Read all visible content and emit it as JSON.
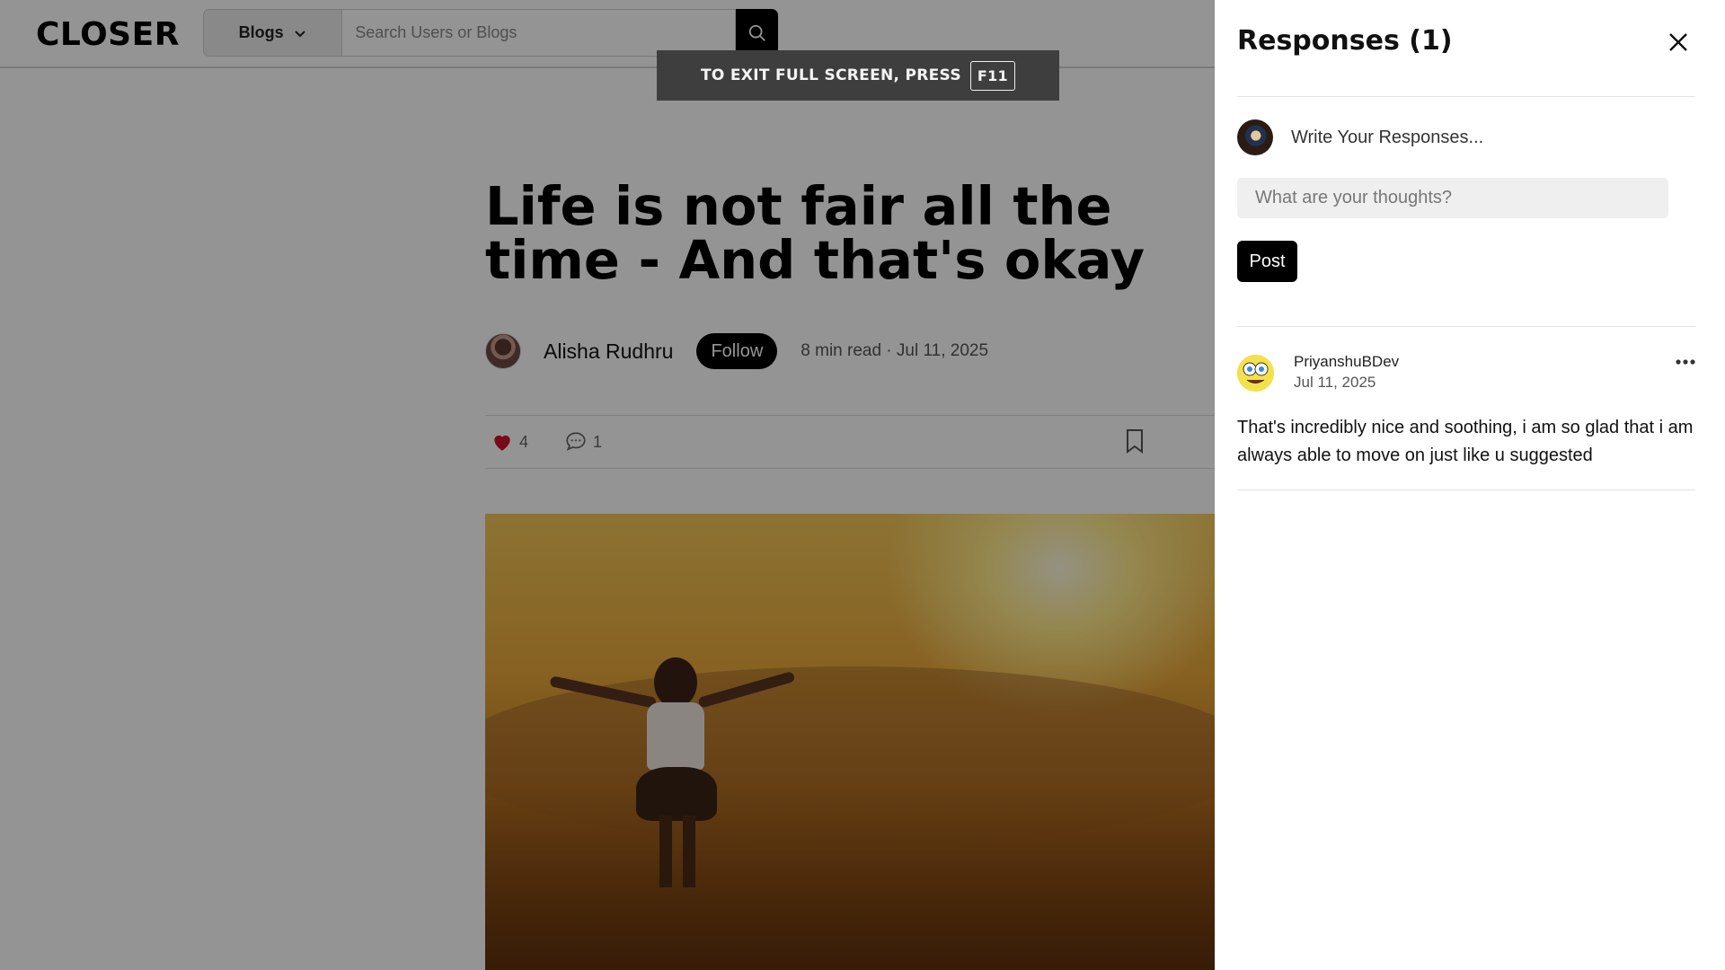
{
  "header": {
    "logo": "CLOSER",
    "dropdown_label": "Blogs",
    "search_placeholder": "Search Users or Blogs"
  },
  "fullscreen_notice": {
    "text": "TO EXIT FULL SCREEN, PRESS",
    "key": "F11"
  },
  "article": {
    "title": "Life is not fair all the time - And that's okay",
    "author": "Alisha Rudhru",
    "follow_label": "Follow",
    "meta": "8 min read · Jul 11, 2025",
    "likes": "4",
    "comments": "1"
  },
  "panel": {
    "title": "Responses (1)",
    "write_prompt": "Write Your Responses...",
    "thoughts_placeholder": "What are your thoughts?",
    "post_label": "Post",
    "responses": [
      {
        "user": "PriyanshuBDev",
        "date": "Jul 11, 2025",
        "text": "That's incredibly nice and soothing, i am so glad that i am always able to move on just like u suggested"
      }
    ]
  },
  "colors": {
    "accent": "#000000",
    "like_heart": "#d0102a",
    "overlay": "rgba(0,0,0,0.42)"
  },
  "icons": [
    "chevron-down-icon",
    "search-icon",
    "heart-icon",
    "comment-icon",
    "bookmark-icon",
    "close-icon",
    "more-icon"
  ]
}
